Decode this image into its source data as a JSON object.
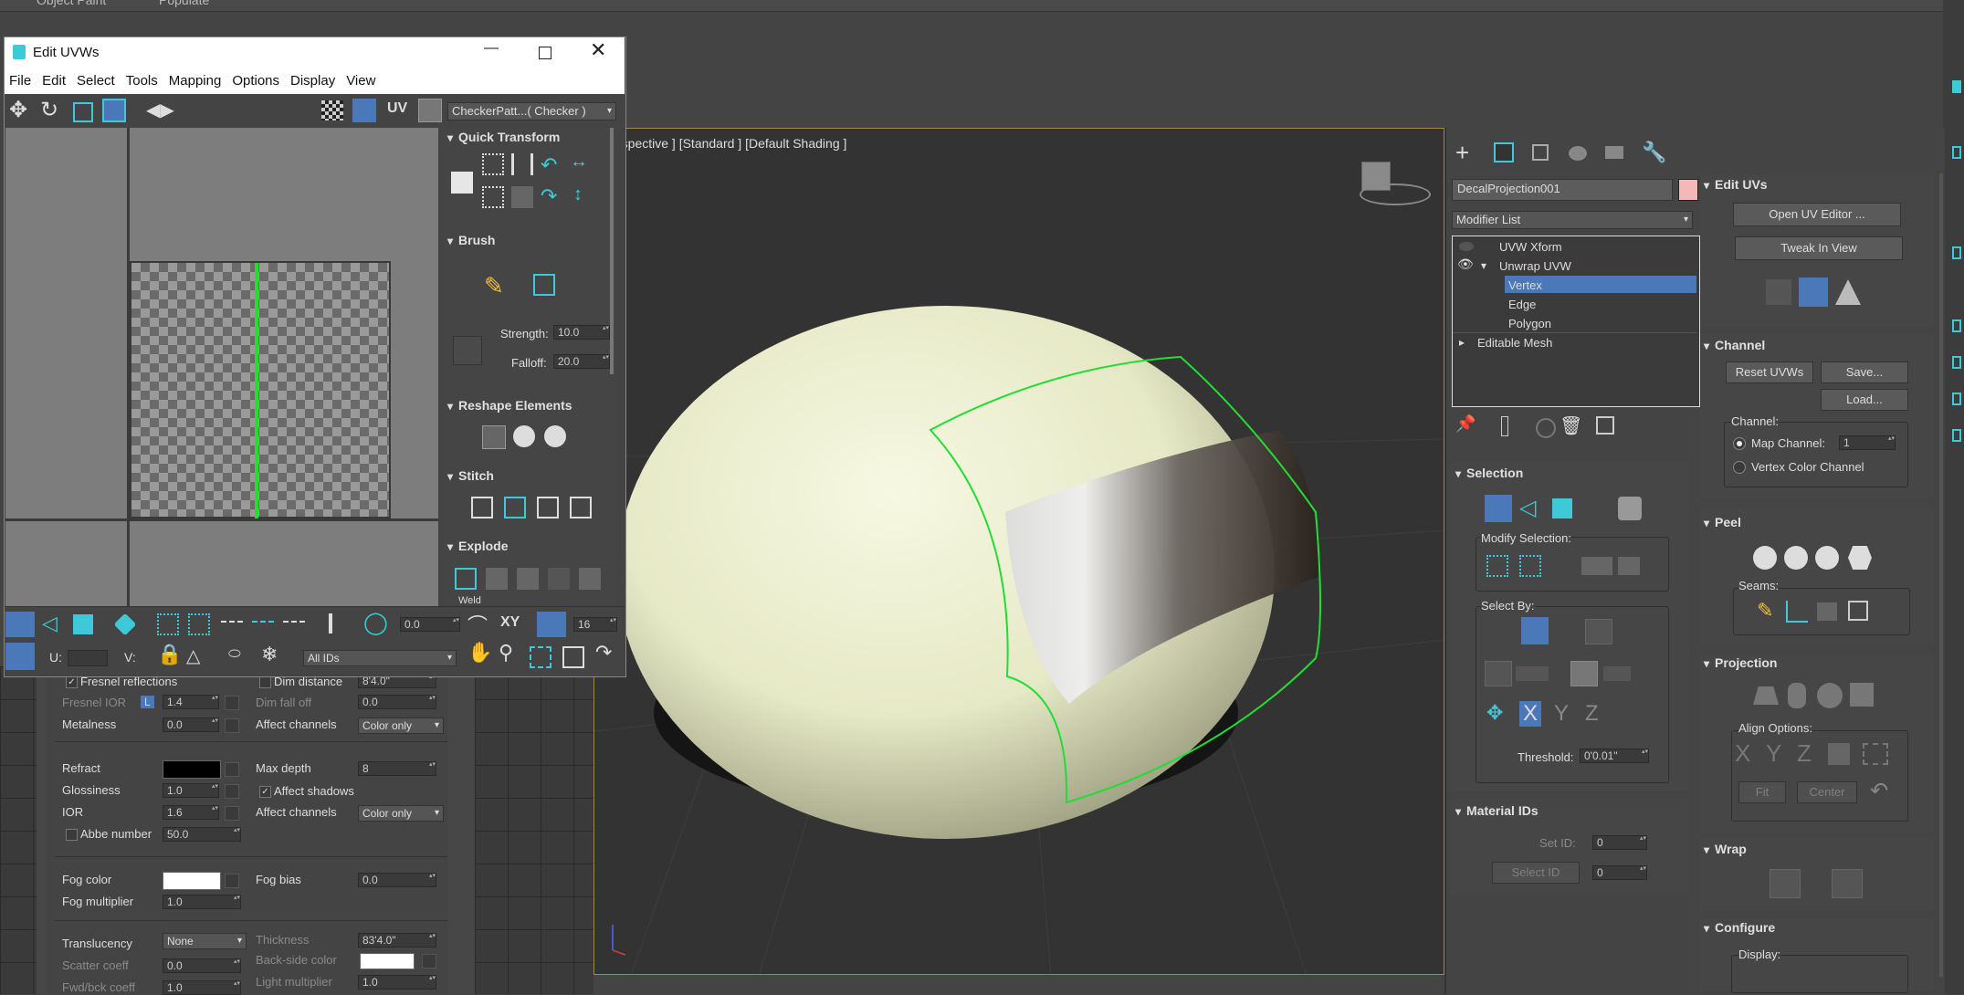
{
  "top_bar": {
    "object_paint": "Object Paint",
    "populate": "Populate"
  },
  "uvw_window": {
    "title": "Edit UVWs",
    "menu": [
      "File",
      "Edit",
      "Select",
      "Tools",
      "Mapping",
      "Options",
      "Display",
      "View"
    ],
    "toolbar": {
      "uv_label": "UV",
      "checker_dropdown": "CheckerPatt...( Checker )"
    },
    "panels": {
      "quick_transform": "Quick Transform",
      "brush": "Brush",
      "strength_label": "Strength:",
      "strength_value": "10.0",
      "falloff_label": "Falloff:",
      "falloff_value": "20.0",
      "reshape": "Reshape Elements",
      "stitch": "Stitch",
      "explode": "Explode",
      "weld": "Weld"
    },
    "bottom": {
      "rotate_value": "0.0",
      "xy_label": "XY",
      "grid_value": "16",
      "u_label": "U:",
      "v_label": "V:",
      "ids_dropdown": "All IDs"
    }
  },
  "material": {
    "fresnel": "Fresnel reflections",
    "fresnel_ior": "Fresnel IOR",
    "fresnel_ior_l": "L",
    "fresnel_ior_val": "1.4",
    "dim_distance": "Dim distance",
    "dim_distance_val": "8'4.0\"",
    "dim_falloff": "Dim fall off",
    "dim_falloff_val": "0.0",
    "metalness": "Metalness",
    "metalness_val": "0.0",
    "affect_channels": "Affect channels",
    "color_only": "Color only",
    "refract": "Refract",
    "max_depth": "Max depth",
    "max_depth_val": "8",
    "glossiness": "Glossiness",
    "glossiness_val": "1.0",
    "affect_shadows": "Affect shadows",
    "ior": "IOR",
    "ior_val": "1.6",
    "affect_channels2": "Affect channels",
    "color_only2": "Color only",
    "abbe": "Abbe number",
    "abbe_val": "50.0",
    "fog_color": "Fog color",
    "fog_bias": "Fog bias",
    "fog_bias_val": "0.0",
    "fog_mult": "Fog multiplier",
    "fog_mult_val": "1.0",
    "translucency": "Translucency",
    "translucency_val": "None",
    "thickness": "Thickness",
    "thickness_val": "83'4.0\"",
    "scatter": "Scatter coeff",
    "scatter_val": "0.0",
    "backside": "Back-side color",
    "fwd": "Fwd/bck coeff",
    "fwd_val": "1.0",
    "light_mult": "Light multiplier",
    "light_mult_val": "1.0"
  },
  "viewport": {
    "label": "[Perspective ] [Standard ] [Default Shading ]"
  },
  "command_panel": {
    "object_name": "DecalProjection001",
    "modifier_list": "Modifier List",
    "stack": [
      {
        "label": "UVW Xform"
      },
      {
        "label": "Unwrap UVW"
      },
      {
        "label": "Vertex"
      },
      {
        "label": "Edge"
      },
      {
        "label": "Polygon"
      },
      {
        "label": "Editable Mesh"
      }
    ],
    "selection": {
      "title": "Selection",
      "modify_selection": "Modify Selection:",
      "select_by": "Select By:",
      "threshold_label": "Threshold:",
      "threshold_val": "0'0.01\""
    },
    "material_ids": {
      "title": "Material IDs",
      "set_id": "Set ID:",
      "set_id_val": "0",
      "select_id": "Select ID",
      "select_id_val": "0"
    },
    "edit_uvs": {
      "title": "Edit UVs",
      "open_editor": "Open UV Editor ...",
      "tweak": "Tweak In View"
    },
    "channel": {
      "title": "Channel",
      "reset": "Reset UVWs",
      "save": "Save...",
      "load": "Load...",
      "channel_label": "Channel:",
      "map_channel": "Map Channel:",
      "map_channel_val": "1",
      "vertex_color": "Vertex Color Channel"
    },
    "peel": {
      "title": "Peel",
      "seams": "Seams:"
    },
    "projection": {
      "title": "Projection",
      "align": "Align Options:",
      "x": "X",
      "y": "Y",
      "z": "Z",
      "fit": "Fit",
      "center": "Center"
    },
    "wrap": {
      "title": "Wrap"
    },
    "configure": {
      "title": "Configure",
      "display": "Display:"
    }
  },
  "colors": {
    "accent": "#3ec9d8",
    "selection": "#4a78b8",
    "uv_seam": "#22dd33",
    "sphere": "#e3e6c8"
  }
}
